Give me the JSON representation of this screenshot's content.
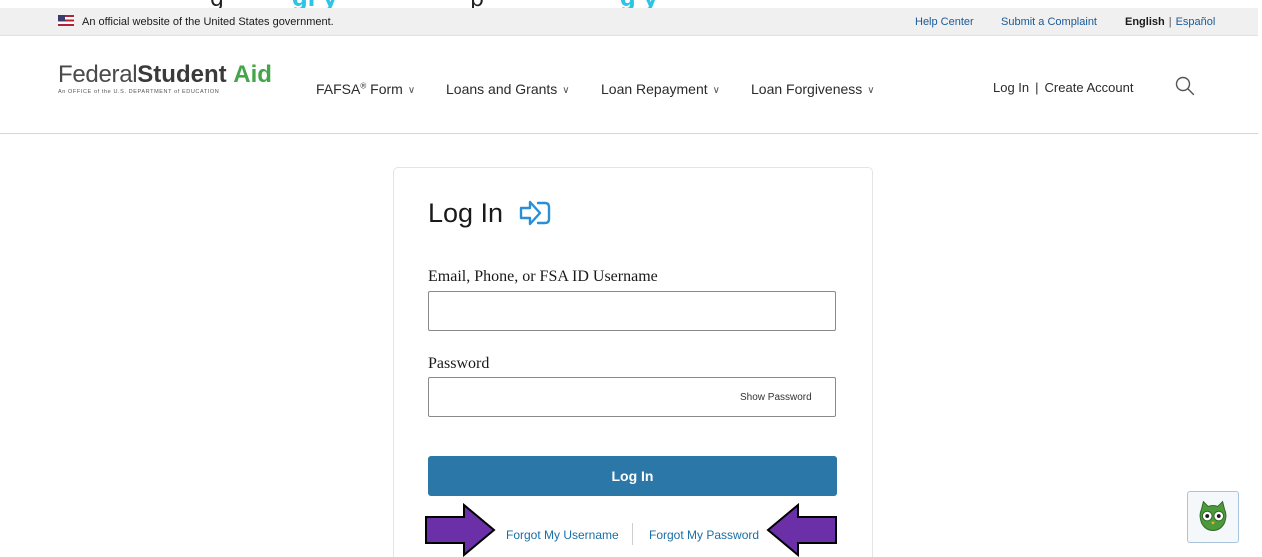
{
  "caption": {
    "part_a": "g",
    "part_b": "gi y",
    "part_c": "p",
    "part_d": "g y"
  },
  "gov_banner": {
    "official_text": "An official website of the United States government.",
    "help_center": "Help Center",
    "submit_complaint": "Submit a Complaint",
    "lang_english": "English",
    "lang_separator": "|",
    "lang_spanish": "Español"
  },
  "header": {
    "logo_federal": "Federal",
    "logo_student": "Student",
    "logo_aid": "Aid",
    "logo_subtitle": "An OFFICE of the U.S. DEPARTMENT of EDUCATION",
    "nav": {
      "fafsa_label": "FAFSA",
      "fafsa_sup": "®",
      "fafsa_suffix": " Form",
      "loans_grants": "Loans and Grants",
      "loan_repayment": "Loan Repayment",
      "loan_forgiveness": "Loan Forgiveness"
    },
    "log_in": "Log In",
    "separator": "|",
    "create_account": "Create Account"
  },
  "login_card": {
    "title": "Log In",
    "username_label": "Email, Phone, or FSA ID Username",
    "username_value": "",
    "password_label": "Password",
    "password_value": "",
    "show_password": "Show Password",
    "login_button": "Log In",
    "forgot_username": "Forgot My Username",
    "forgot_password": "Forgot My Password"
  },
  "colors": {
    "brand_green": "#45a649",
    "button_blue": "#2a77a8",
    "link_blue": "#1a6fa5",
    "arrow_purple": "#6b2fa8"
  },
  "icons": {
    "flag": "us-flag-icon",
    "search": "search-icon",
    "login": "login-arrow-icon",
    "chat": "owl-chat-icon"
  }
}
